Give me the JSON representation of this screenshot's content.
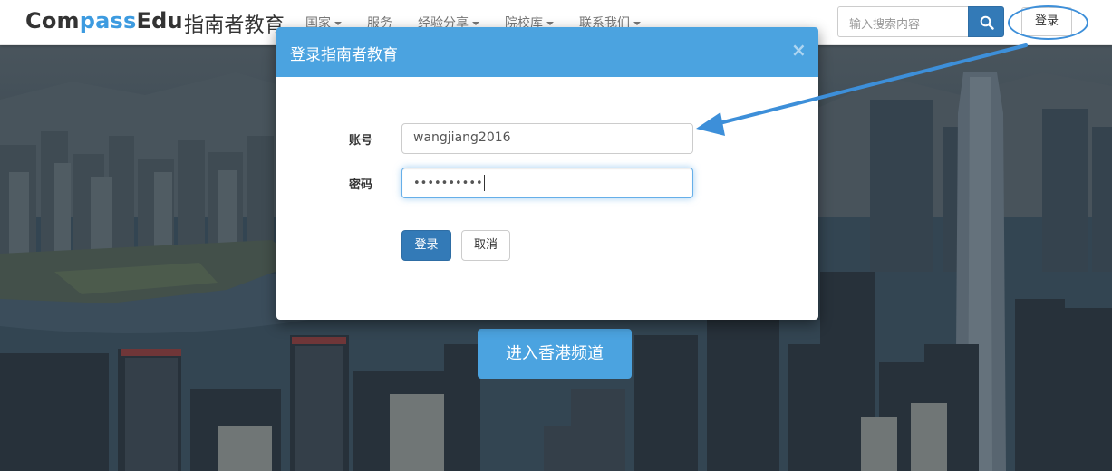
{
  "brand": {
    "logo_part1": "Com",
    "logo_part2": "pass",
    "logo_part3": "Edu",
    "name_cn": "指南者教育"
  },
  "nav": {
    "items": [
      {
        "label": "国家",
        "dropdown": true
      },
      {
        "label": "服务",
        "dropdown": false
      },
      {
        "label": "经验分享",
        "dropdown": true
      },
      {
        "label": "院校库",
        "dropdown": true
      },
      {
        "label": "联系我们",
        "dropdown": true
      }
    ]
  },
  "search": {
    "placeholder": "输入搜索内容",
    "icon": "search-icon"
  },
  "header": {
    "login_label": "登录"
  },
  "modal": {
    "title": "登录指南者教育",
    "close_symbol": "×",
    "account_label": "账号",
    "account_value": "wangjiang2016",
    "password_label": "密码",
    "password_masked": "••••••••••",
    "submit_label": "登录",
    "cancel_label": "取消"
  },
  "hero": {
    "cta_label": "进入香港频道"
  },
  "colors": {
    "accent": "#4ba3e0",
    "primary_button": "#337ab7",
    "annotation": "#3d8fd9"
  }
}
